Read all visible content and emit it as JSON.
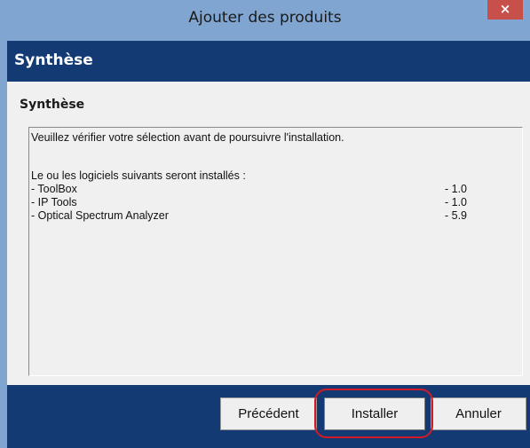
{
  "window": {
    "title": "Ajouter des produits",
    "close_glyph": "×"
  },
  "header": {
    "title": "Synthèse"
  },
  "panel": {
    "title": "Synthèse",
    "intro": "Veuillez vérifier votre sélection avant de poursuivre l'installation.",
    "list_heading": "Le ou les logiciels suivants seront installés :",
    "products": [
      {
        "name": "- ToolBox",
        "version": "- 1.0"
      },
      {
        "name": "- IP Tools",
        "version": "- 1.0"
      },
      {
        "name": "- Optical Spectrum Analyzer",
        "version": "- 5.9"
      }
    ]
  },
  "footer": {
    "previous_label": "Précédent",
    "install_label": "Installer",
    "cancel_label": "Annuler"
  },
  "colors": {
    "titlebar": "#7fa5d0",
    "band": "#133a73",
    "close": "#c7514a",
    "highlight": "#d21a26"
  }
}
